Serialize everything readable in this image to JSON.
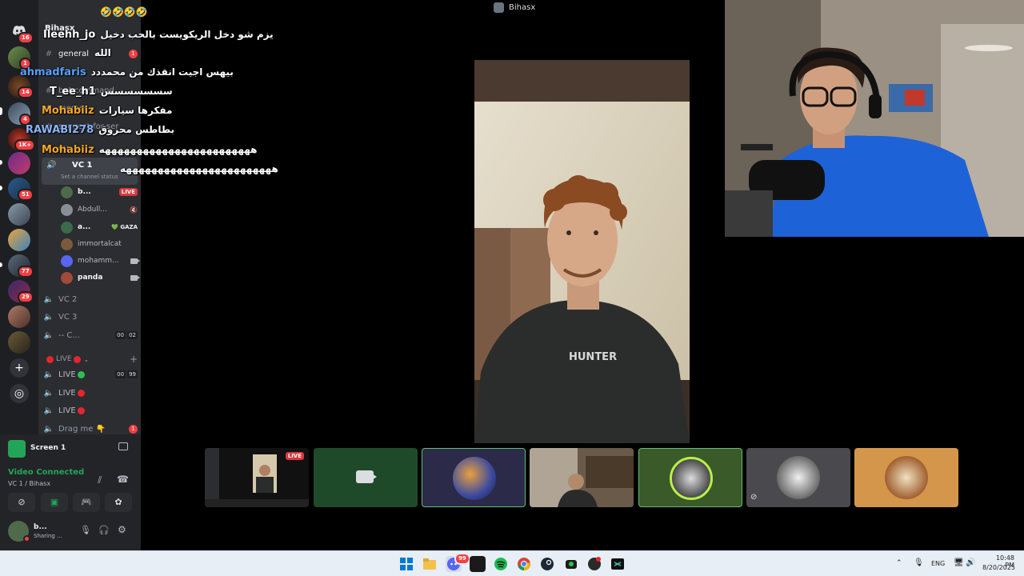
{
  "stage": {
    "streamer": "Bihasx",
    "live_label": "LIVE",
    "shirt_text": "HUNTER"
  },
  "rail": {
    "badges": [
      "16",
      "1",
      "14",
      "4",
      "1K+",
      "51",
      "77",
      "29"
    ]
  },
  "sidebar": {
    "server_name": "Bihasx",
    "channels": [
      {
        "icon": "#",
        "label": "general",
        "unread": "1"
      },
      {
        "icon": "#",
        "label": "bot-command"
      },
      {
        "icon": "#",
        "label": "memes"
      },
      {
        "icon": "#",
        "label": "suggest-for-ser"
      },
      {
        "icon": "#",
        "label": "qu..."
      }
    ],
    "active_voice": {
      "label": "VC 1",
      "status_hint": "Set a channel status"
    },
    "voice_users": [
      {
        "name": "b...",
        "tag": "LIVE"
      },
      {
        "name": "Abdull..."
      },
      {
        "name": "a...",
        "extra": "💚 GAZA"
      },
      {
        "name": "immortalcat"
      },
      {
        "name": "mohamm..."
      },
      {
        "name": "panda"
      }
    ],
    "voice_channels": [
      {
        "label": "VC 2"
      },
      {
        "label": "VC 3"
      },
      {
        "label": "-- C...",
        "count_a": "00",
        "count_b": "02"
      }
    ],
    "category": {
      "label": "LIVE"
    },
    "live_channels": [
      {
        "label": "LIVE",
        "count_a": "00",
        "count_b": "99"
      },
      {
        "label": "LIVE"
      },
      {
        "label": "LIVE"
      },
      {
        "label": "Drag me 👇",
        "unread": "1"
      }
    ]
  },
  "panel": {
    "stream_label": "Screen 1",
    "connection": "Video Connected",
    "location": "VC 1 / Bihasx",
    "user_name": "b...",
    "user_status": "Sharing ..."
  },
  "chat": [
    {
      "user": "Ileehh_jo",
      "color": "#ffffff",
      "message": "يزم شو دخل الريكويست بالحب دخيل"
    },
    {
      "user": "",
      "color": "#ffffff",
      "message": "الله"
    },
    {
      "user": "ahmadfaris",
      "color": "#5aa0ff",
      "message": "بيهس اجيت انقذك من محمددد"
    },
    {
      "user": "T_ee_h1",
      "color": "#ffffff",
      "message": "سسسسسسس"
    },
    {
      "user": "Mohabiiz",
      "color": "#f5a623",
      "message": "مفكرها سيارات"
    },
    {
      "user": "RAWABI278",
      "color": "#8ab4f8",
      "message": "بطاطس محروق"
    },
    {
      "user": "Mohabiiz",
      "color": "#f5a623",
      "message": "ههههههههههههههههههههههههه"
    },
    {
      "user": "",
      "color": "#ffffff",
      "message": "ههههههههههههههههههههههههه"
    }
  ],
  "chat_top_emojis": "🤣🤣🤣🤣",
  "taskbar": {
    "lang": "ENG",
    "time": "10:48 PM",
    "date": "8/20/2025",
    "discord_badge": "99"
  }
}
